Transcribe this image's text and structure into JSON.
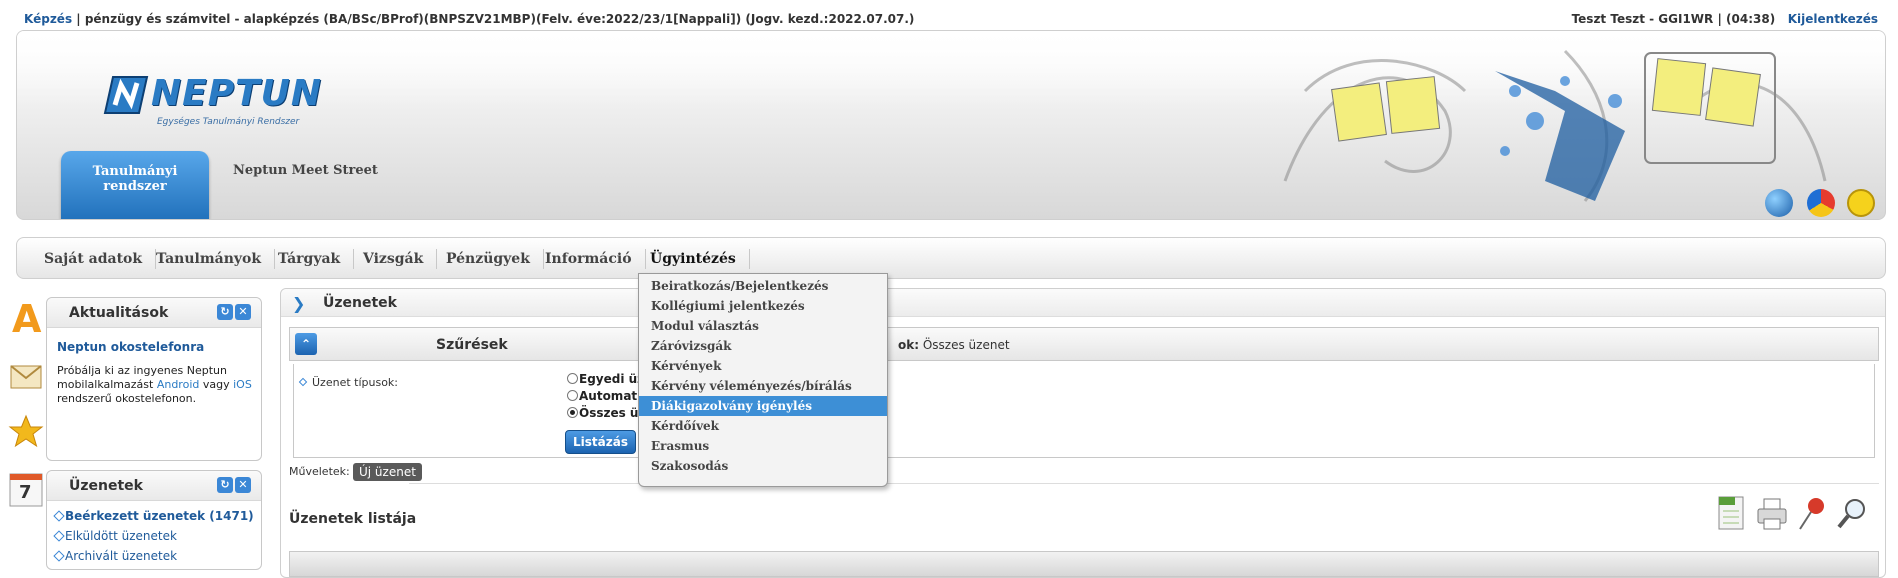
{
  "topbar": {
    "kepzes_link": "Képzés",
    "program": " |  pénzügy és számvitel - alapképzés (BA/BSc/BProf)(BNPSZV21MBP)(Felv. éve:2022/23/1[Nappali]) (Jogv. kezd.:2022.07.07.)",
    "user": "Teszt Teszt - GGI1WR  |   (04:38)",
    "logout": "Kijelentkezés"
  },
  "header": {
    "logo_word": "NEPTUN",
    "logo_sub": "Egységes Tanulmányi Rendszer",
    "system_tab": "Tanulmányi rendszer",
    "meet_street": "Neptun Meet Street",
    "icons": [
      "globe-icon",
      "color-wheel-icon",
      "accessibility-icon"
    ]
  },
  "nav": {
    "items": [
      {
        "label": "Saját adatok"
      },
      {
        "label": "Tanulmányok"
      },
      {
        "label": "Tárgyak"
      },
      {
        "label": "Vizsgák"
      },
      {
        "label": "Pénzügyek"
      },
      {
        "label": "Információ"
      },
      {
        "label": "Ügyintézés"
      }
    ],
    "active": "Ügyintézés"
  },
  "dropdown": {
    "items": [
      "Beiratkozás/Bejelentkezés",
      "Kollégiumi jelentkezés",
      "Modul választás",
      "Záróvizsgák",
      "Kérvények",
      "Kérvény véleményezés/bírálás",
      "Diákigazolvány igénylés",
      "Kérdőívek",
      "Erasmus",
      "Szakosodás"
    ],
    "highlighted": "Diákigazolvány igénylés"
  },
  "sidebar": {
    "icons": [
      "a-letter-icon",
      "envelope-icon",
      "star-icon",
      "calendar-icon"
    ],
    "calendar_day": "7",
    "news": {
      "title": "Aktualitások",
      "headline": "Neptun okostelefonra",
      "text_1": "Próbálja ki az ingyenes Neptun mobilalkalmazást ",
      "android": "Android",
      "text_2": " vagy ",
      "ios": "iOS",
      "text_3": " rendszerű okostelefonon."
    },
    "messages": {
      "title": "Üzenetek",
      "items": [
        "Beérkezett üzenetek (1471)",
        "Elküldött üzenetek",
        "Archivált üzenetek"
      ]
    }
  },
  "main": {
    "title": "Üzenetek",
    "filter": {
      "title": "Szűrések",
      "selection_label": "ok:",
      "selection_value": "Összes üzenet",
      "type_label": "Üzenet típusok:",
      "radios": [
        {
          "label": "Egyedi üz",
          "checked": false
        },
        {
          "label": "Automatil",
          "checked": false
        },
        {
          "label": "Összes üz",
          "checked": true
        }
      ],
      "list_button": "Listázás"
    },
    "ops_label": "Műveletek:",
    "ops_new": "Új üzenet",
    "list_title": "Üzenetek listája",
    "tools": [
      "excel-icon",
      "printer-icon",
      "pin-icon",
      "search-icon"
    ]
  },
  "colors": {
    "accent": "#2a7bc4",
    "highlight": "#3d8fd6",
    "link": "#1f5a9a"
  }
}
